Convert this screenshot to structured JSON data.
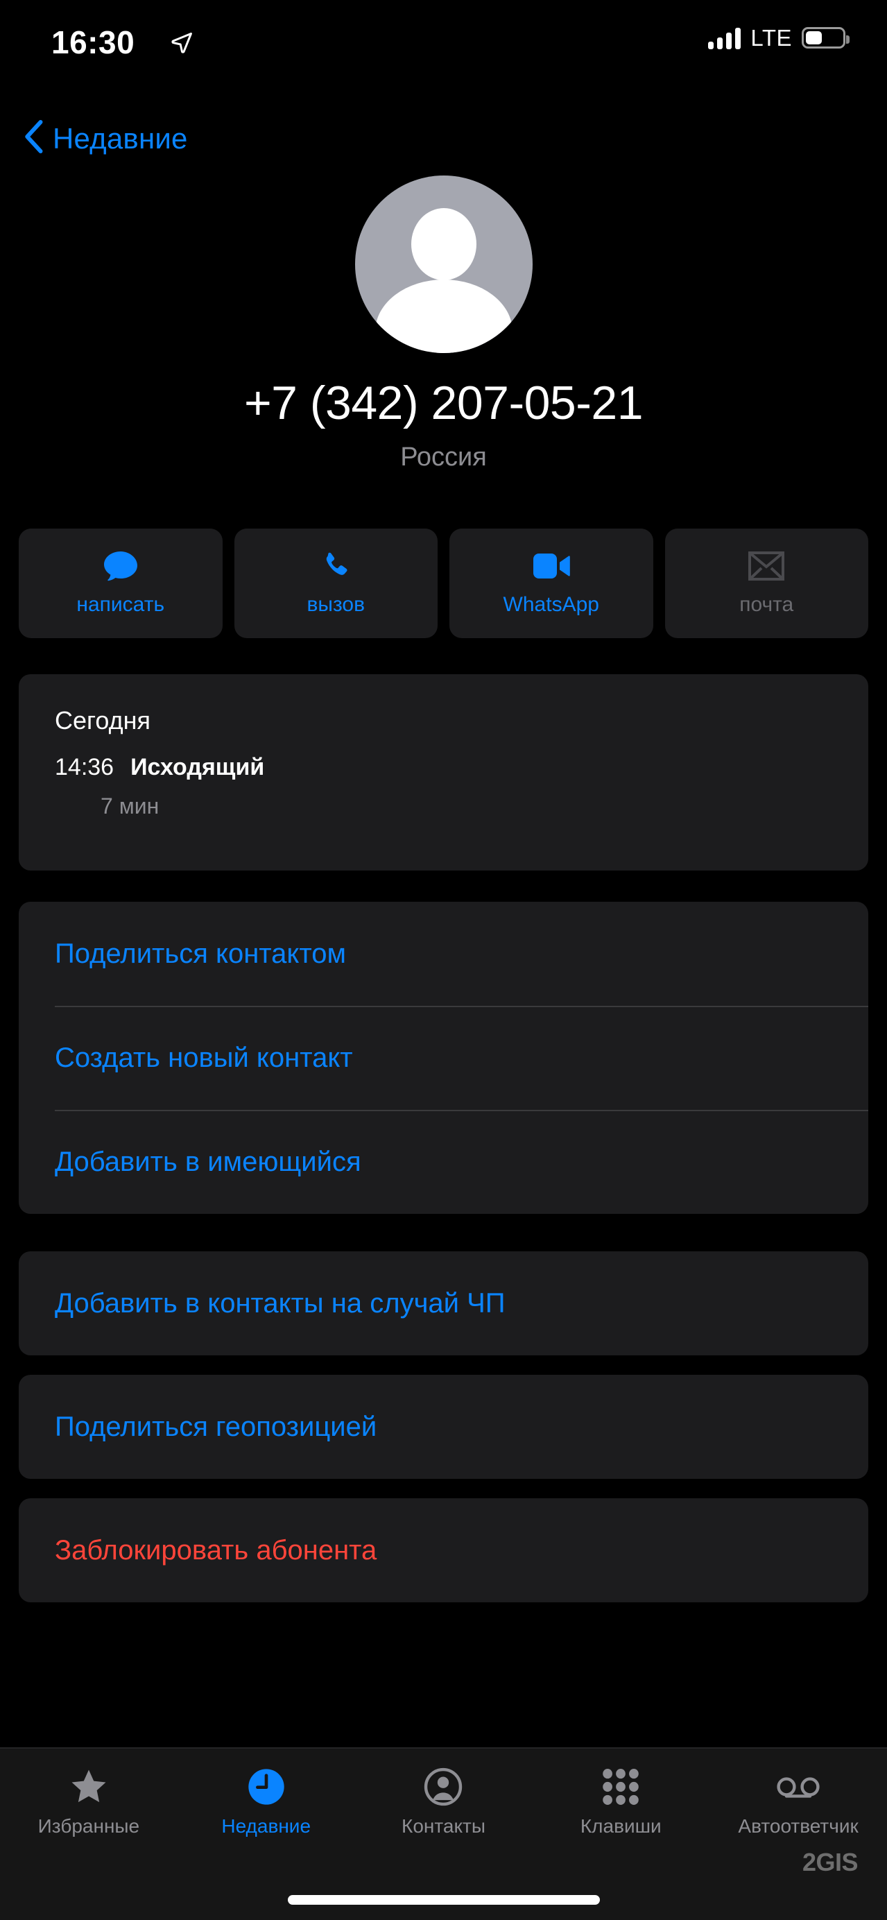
{
  "status_bar": {
    "time": "16:30",
    "location_icon": "location-arrow-icon",
    "signal_icon": "cellular-signal-icon",
    "network": "LTE",
    "battery_icon": "battery-icon",
    "battery_level_percent": 40
  },
  "nav": {
    "back_label": "Недавние",
    "back_icon": "chevron-left-icon"
  },
  "contact": {
    "avatar_icon": "default-person-avatar-icon",
    "phone_number": "+7 (342) 207-05-21",
    "country": "Россия"
  },
  "quick_actions": [
    {
      "label": "написать",
      "icon": "message-bubble-icon",
      "enabled": true
    },
    {
      "label": "вызов",
      "icon": "phone-handset-icon",
      "enabled": true
    },
    {
      "label": "WhatsApp",
      "icon": "video-camera-icon",
      "enabled": true
    },
    {
      "label": "почта",
      "icon": "envelope-icon",
      "enabled": false
    }
  ],
  "call_history": {
    "day": "Сегодня",
    "time": "14:36",
    "type": "Исходящий",
    "duration": "7 мин"
  },
  "action_groups": [
    {
      "items": [
        {
          "label": "Поделиться контактом",
          "style": "normal"
        },
        {
          "label": "Создать новый контакт",
          "style": "normal"
        },
        {
          "label": "Добавить в имеющийся",
          "style": "normal"
        }
      ]
    },
    {
      "items": [
        {
          "label": "Добавить в контакты на случай ЧП",
          "style": "normal"
        }
      ]
    },
    {
      "items": [
        {
          "label": "Поделиться геопозицией",
          "style": "normal"
        }
      ]
    },
    {
      "items": [
        {
          "label": "Заблокировать абонента",
          "style": "danger"
        }
      ]
    }
  ],
  "tab_bar": [
    {
      "label": "Избранные",
      "icon": "star-icon",
      "active": false
    },
    {
      "label": "Недавние",
      "icon": "clock-icon",
      "active": true
    },
    {
      "label": "Контакты",
      "icon": "person-circle-icon",
      "active": false
    },
    {
      "label": "Клавиши",
      "icon": "keypad-icon",
      "active": false
    },
    {
      "label": "Автоответчик",
      "icon": "voicemail-icon",
      "active": false
    }
  ],
  "watermark": "2GIS",
  "colors": {
    "accent_blue": "#0a84ff",
    "danger_red": "#ff453a",
    "card_bg": "#1c1c1e",
    "screen_bg": "#000000",
    "secondary_text": "#8d8d92"
  }
}
